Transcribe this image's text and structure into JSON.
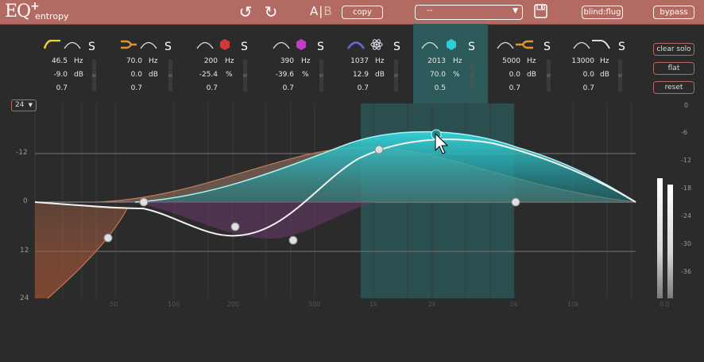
{
  "app": {
    "logo_main": "EQ",
    "logo_plus": "+",
    "logo_sub": "entropy"
  },
  "toolbar": {
    "ab_a": "A",
    "ab_sep": "|",
    "ab_b": "B",
    "copy_label": "copy",
    "preset_value": "--",
    "blind_label": "blind:flug",
    "bypass_label": "bypass"
  },
  "bands": [
    {
      "freq": "46.5",
      "freq_unit": "Hz",
      "gain": "-9.0",
      "gain_unit": "dB",
      "q": "0.7",
      "solo": "S",
      "color": "#f0d23c",
      "icon": "lowshelf-icon"
    },
    {
      "freq": "70.0",
      "freq_unit": "Hz",
      "gain": "0.0",
      "gain_unit": "dB",
      "q": "0.7",
      "solo": "S",
      "color": "#e0962c",
      "icon": "highpass-icon"
    },
    {
      "freq": "200",
      "freq_unit": "Hz",
      "gain": "-25.4",
      "gain_unit": "%",
      "q": "0.7",
      "solo": "S",
      "color": "#d23a3a",
      "icon": "entropy-hex-icon"
    },
    {
      "freq": "390",
      "freq_unit": "Hz",
      "gain": "-39.6",
      "gain_unit": "%",
      "q": "0.7",
      "solo": "S",
      "color": "#c43ccc",
      "icon": "entropy-hex-icon"
    },
    {
      "freq": "1037",
      "freq_unit": "Hz",
      "gain": "12.9",
      "gain_unit": "dB",
      "q": "0.7",
      "solo": "S",
      "color": "#8fa0ff",
      "icon": "atom-icon"
    },
    {
      "freq": "2013",
      "freq_unit": "Hz",
      "gain": "70.0",
      "gain_unit": "%",
      "q": "0.5",
      "solo": "S",
      "color": "#2fd0d8",
      "icon": "entropy-hex-icon"
    },
    {
      "freq": "5000",
      "freq_unit": "Hz",
      "gain": "0.0",
      "gain_unit": "dB",
      "q": "0.7",
      "solo": "S",
      "color": "#e0962c",
      "icon": "lowpass-icon"
    },
    {
      "freq": "13000",
      "freq_unit": "Hz",
      "gain": "0.0",
      "gain_unit": "dB",
      "q": "0.7",
      "solo": "S",
      "color": "#ffffff",
      "icon": "highshelf-icon"
    }
  ],
  "side": {
    "clear_solo": "clear solo",
    "flat": "flat",
    "reset": "reset"
  },
  "range": {
    "value": "24",
    "arrow": "▼"
  },
  "db_left": [
    "-12",
    "0",
    "12",
    "24"
  ],
  "db_right": [
    "0",
    "-6",
    "-12",
    "-18",
    "-24",
    "-30",
    "-36"
  ],
  "freq_labels": [
    "50",
    "100",
    "200",
    "500",
    "1k",
    "2k",
    "5k",
    "10k",
    "0.0"
  ],
  "colors": {
    "accent": "#b26a63",
    "teal": "#2fd0d8",
    "selection": "#2d5a5a"
  }
}
